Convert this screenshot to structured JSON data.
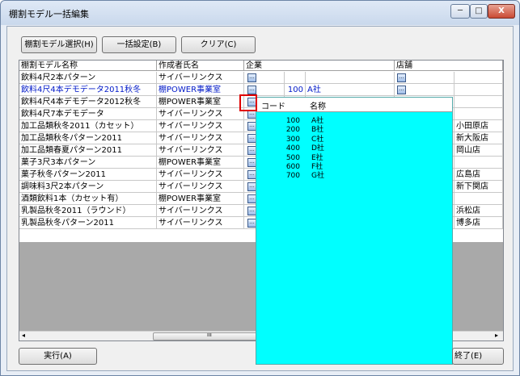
{
  "window": {
    "title": "棚割モデル一括編集",
    "min": "─",
    "max": "□",
    "close": "X"
  },
  "toolbar": {
    "select_label": "棚割モデル選択(H)",
    "bulk_label": "一括設定(B)",
    "clear_label": "クリア(C)"
  },
  "columns": {
    "model_name": "棚割モデル名称",
    "creator": "作成者氏名",
    "company": "企業",
    "store": "店舗"
  },
  "rows": [
    {
      "name": "飲料4尺2本パターン",
      "creator": "サイバーリンクス",
      "code": "",
      "company": "",
      "store": "",
      "highlight": false
    },
    {
      "name": "飲料4尺4本デモデータ2011秋冬",
      "creator": "棚POWER事業室",
      "code": "100",
      "company": "A社",
      "store": "",
      "highlight": true
    },
    {
      "name": "飲料4尺4本デモデータ2012秋冬",
      "creator": "棚POWER事業室",
      "code": "",
      "company": "",
      "store": "",
      "highlight": false
    },
    {
      "name": "飲料4尺7本デモデータ",
      "creator": "サイバーリンクス",
      "code": "",
      "company": "",
      "store": "",
      "highlight": false
    },
    {
      "name": "加工品類秋冬2011（カセット）",
      "creator": "サイバーリンクス",
      "code": "",
      "company": "",
      "store": "小田原店",
      "highlight": false
    },
    {
      "name": "加工品類秋冬パターン2011",
      "creator": "サイバーリンクス",
      "code": "",
      "company": "",
      "store": "新大阪店",
      "highlight": false
    },
    {
      "name": "加工品類春夏パターン2011",
      "creator": "サイバーリンクス",
      "code": "",
      "company": "",
      "store": "岡山店",
      "highlight": false
    },
    {
      "name": "菓子3尺3本パターン",
      "creator": "棚POWER事業室",
      "code": "",
      "company": "",
      "store": "",
      "highlight": false
    },
    {
      "name": "菓子秋冬パターン2011",
      "creator": "サイバーリンクス",
      "code": "",
      "company": "",
      "store": "広島店",
      "highlight": false
    },
    {
      "name": "調味料3尺2本パターン",
      "creator": "サイバーリンクス",
      "code": "",
      "company": "",
      "store": "新下関店",
      "highlight": false
    },
    {
      "name": "酒類飲料1本（カセット有）",
      "creator": "棚POWER事業室",
      "code": "",
      "company": "",
      "store": "",
      "highlight": false
    },
    {
      "name": "乳製品秋冬2011（ラウンド）",
      "creator": "サイバーリンクス",
      "code": "",
      "company": "",
      "store": "浜松店",
      "highlight": false
    },
    {
      "name": "乳製品秋冬パターン2011",
      "creator": "サイバーリンクス",
      "code": "",
      "company": "",
      "store": "博多店",
      "highlight": false
    }
  ],
  "dropdown": {
    "code_header": "コード",
    "name_header": "名称",
    "items": [
      {
        "code": "100",
        "name": "A社"
      },
      {
        "code": "200",
        "name": "B社"
      },
      {
        "code": "300",
        "name": "C社"
      },
      {
        "code": "400",
        "name": "D社"
      },
      {
        "code": "500",
        "name": "E社"
      },
      {
        "code": "600",
        "name": "F社"
      },
      {
        "code": "700",
        "name": "G社"
      }
    ]
  },
  "ellipsis": "...",
  "scroll": {
    "left": "◂",
    "right": "▸",
    "thumb": "ııı"
  },
  "footer": {
    "run_label": "実行(A)",
    "close_label": "終了(E)"
  }
}
